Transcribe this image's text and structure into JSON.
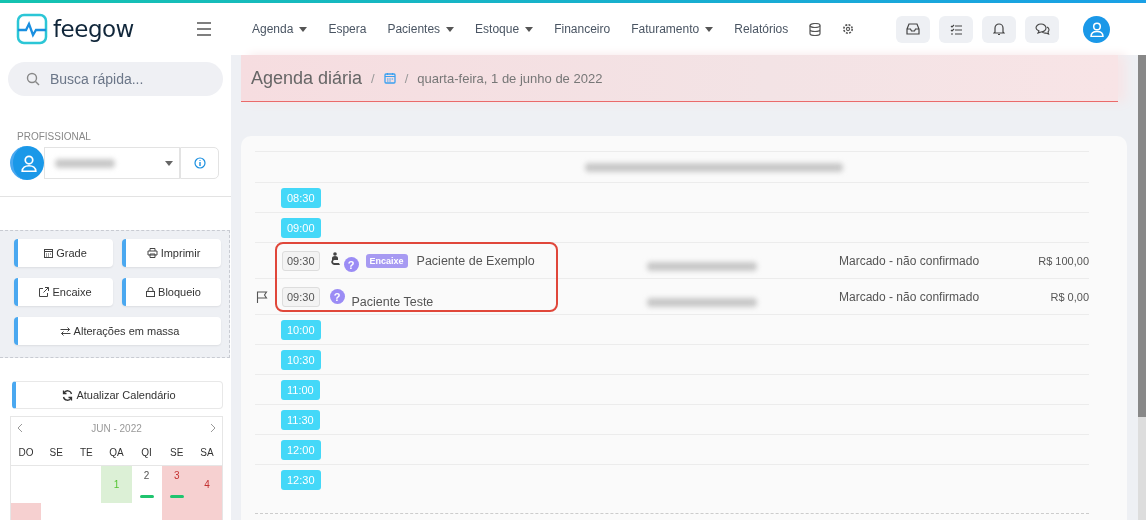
{
  "logo": {
    "text": "feegow"
  },
  "nav": [
    {
      "label": "Agenda",
      "dropdown": true
    },
    {
      "label": "Espera",
      "dropdown": false
    },
    {
      "label": "Pacientes",
      "dropdown": true
    },
    {
      "label": "Estoque",
      "dropdown": true
    },
    {
      "label": "Financeiro",
      "dropdown": false
    },
    {
      "label": "Faturamento",
      "dropdown": true
    },
    {
      "label": "Relatórios",
      "dropdown": false
    }
  ],
  "search": {
    "placeholder": "Busca rápida..."
  },
  "professional": {
    "label": "PROFISSIONAL"
  },
  "actions": [
    {
      "label": "Grade"
    },
    {
      "label": "Imprimir"
    },
    {
      "label": "Encaixe"
    },
    {
      "label": "Bloqueio"
    },
    {
      "label": "Alterações em massa"
    }
  ],
  "refresh_button": {
    "label": "Atualizar Calendário"
  },
  "calendar": {
    "month": "JUN - 2022",
    "weekdays": [
      "DO",
      "SE",
      "TE",
      "QA",
      "QI",
      "SE",
      "SA"
    ],
    "weeks": [
      [
        {
          "blank": true
        },
        {
          "blank": true
        },
        {
          "blank": true
        },
        {
          "blank": false,
          "day": "1",
          "color": "#dcf0d6",
          "marked": false
        },
        {
          "blank": false,
          "day": "2",
          "color": "#ffffff",
          "marked": true
        },
        {
          "blank": false,
          "day": "3",
          "color": "#f6d0d0",
          "marked": true
        },
        {
          "blank": false,
          "day": "4",
          "color": "#f6d0d0",
          "marked": false
        }
      ],
      [
        {
          "blank": false,
          "color": "#f6d0d0"
        },
        {
          "blank": true
        },
        {
          "blank": true
        },
        {
          "blank": true
        },
        {
          "blank": true
        },
        {
          "blank": false,
          "color": "#f6d0d0"
        },
        {
          "blank": false,
          "color": "#f6d0d0"
        }
      ]
    ]
  },
  "page": {
    "title": "Agenda diária",
    "separator_1": "/",
    "separator_2": "/",
    "date": "quarta-feira, 1 de junho de 2022"
  },
  "slots": [
    {
      "kind": "free",
      "time": "08:30"
    },
    {
      "kind": "free",
      "time": "09:00"
    },
    {
      "kind": "appointment",
      "time": "09:30",
      "flagged": false,
      "arrival": true,
      "help_mark": "?",
      "tag": "Encaixe",
      "patient": "Paciente de Exemplo",
      "status": "Marcado - não confirmado",
      "price": "R$ 100,00",
      "highlighted": true
    },
    {
      "kind": "appointment",
      "time": "09:30",
      "flagged": true,
      "arrival": false,
      "help_mark": "?",
      "patient": "Paciente Teste",
      "status": "Marcado - não confirmado",
      "price": "R$ 0,00",
      "highlighted": true
    },
    {
      "kind": "free",
      "time": "10:00"
    },
    {
      "kind": "free",
      "time": "10:30"
    },
    {
      "kind": "free",
      "time": "11:00"
    },
    {
      "kind": "free",
      "time": "11:30"
    },
    {
      "kind": "free",
      "time": "12:00"
    },
    {
      "kind": "free",
      "time": "12:30"
    }
  ]
}
